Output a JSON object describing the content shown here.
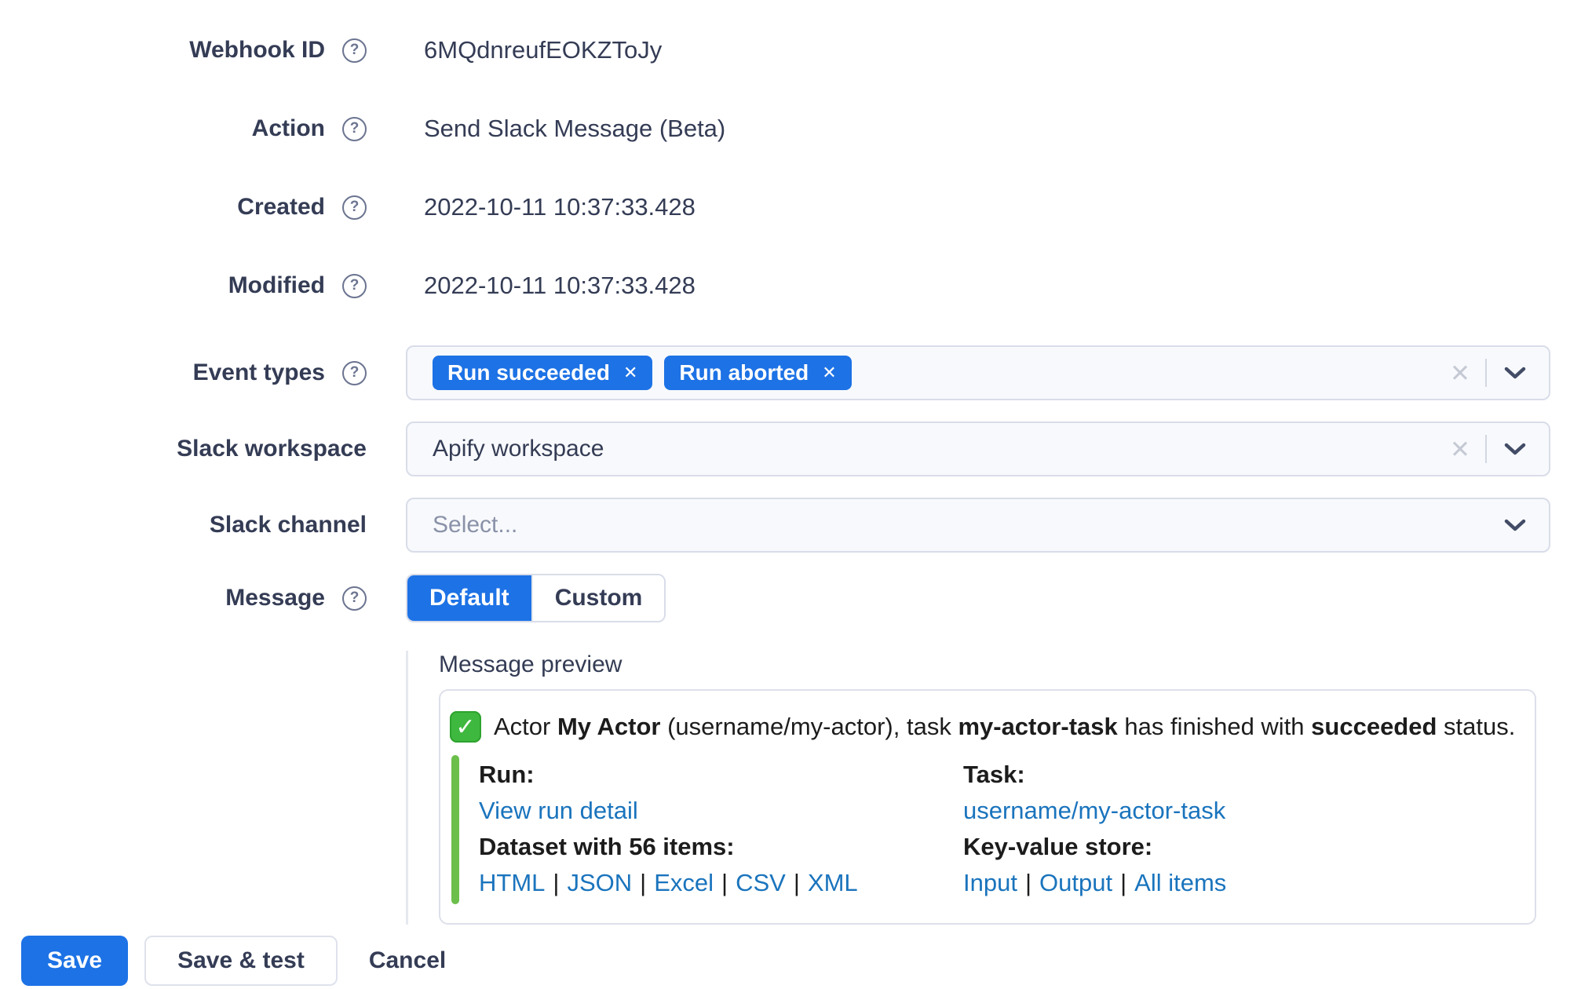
{
  "colors": {
    "primary_blue": "#1d72e5",
    "link_blue": "#1a74bd",
    "success_green": "#6cbf4b"
  },
  "form": {
    "help_icon": "?",
    "webhook_id": {
      "label": "Webhook ID",
      "value": "6MQdnreufEOKZToJy"
    },
    "action": {
      "label": "Action",
      "value": "Send Slack Message (Beta)"
    },
    "created": {
      "label": "Created",
      "value": "2022-10-11 10:37:33.428"
    },
    "modified": {
      "label": "Modified",
      "value": "2022-10-11 10:37:33.428"
    },
    "event_types": {
      "label": "Event types",
      "tags": [
        "Run succeeded",
        "Run aborted"
      ],
      "remove_icon": "✕",
      "clear_icon": "✕"
    },
    "slack_workspace": {
      "label": "Slack workspace",
      "value": "Apify workspace",
      "clear_icon": "✕"
    },
    "slack_channel": {
      "label": "Slack channel",
      "placeholder": "Select..."
    },
    "message": {
      "label": "Message",
      "option_default": "Default",
      "option_custom": "Custom",
      "selected": "Default"
    }
  },
  "preview": {
    "title": "Message preview",
    "check_icon": "✓",
    "headline": {
      "pre": "Actor ",
      "actor_name": "My Actor",
      "mid": " (username/my-actor), task ",
      "task_name": "my-actor-task",
      "mid2": " has finished with ",
      "status": "succeeded",
      "post": " status."
    },
    "run_label": "Run:",
    "run_link": "View run detail",
    "task_label": "Task:",
    "task_link": "username/my-actor-task",
    "dataset_label": "Dataset with 56 items:",
    "dataset_links": [
      "HTML",
      "JSON",
      "Excel",
      "CSV",
      "XML"
    ],
    "kv_label": "Key-value store:",
    "kv_links": [
      "Input",
      "Output",
      "All items"
    ],
    "separator": "|"
  },
  "actions": {
    "save": "Save",
    "save_and_test": "Save & test",
    "cancel": "Cancel"
  }
}
